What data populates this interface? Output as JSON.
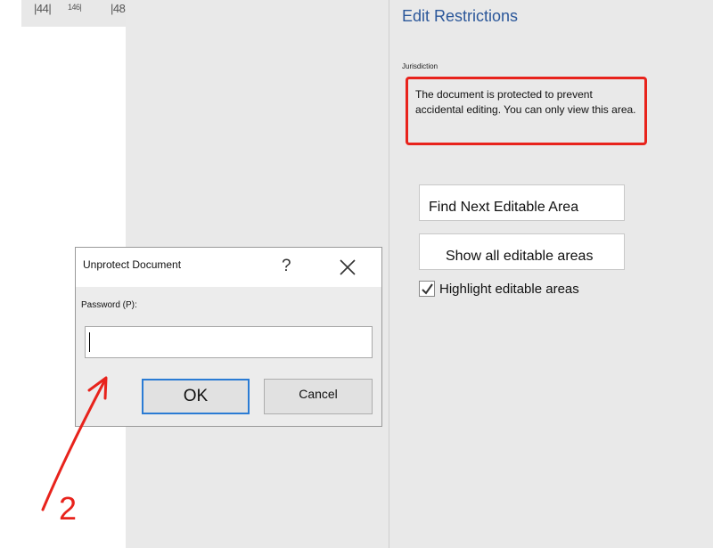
{
  "ruler": {
    "marks": [
      "|44|",
      "146|",
      "|48"
    ]
  },
  "task_pane": {
    "title": "Edit Restrictions",
    "section_label": "Jurisdiction",
    "protection_message": "The document is protected to prevent accidental editing. You can only view this area.",
    "find_next_label": "Find Next Editable Area",
    "show_all_label": "Show all editable areas",
    "highlight_label": "Highlight editable areas",
    "highlight_checked": true
  },
  "dialog": {
    "title": "Unprotect Document",
    "help_glyph": "?",
    "password_label": "Password (P):",
    "password_value": "",
    "ok_label": "OK",
    "cancel_label": "Cancel"
  },
  "annotation": {
    "step_number": "2",
    "color": "#e8231c"
  },
  "colors": {
    "accent_title": "#2b579a",
    "highlight_red": "#e8231c",
    "default_button_border": "#2a7bd4"
  }
}
